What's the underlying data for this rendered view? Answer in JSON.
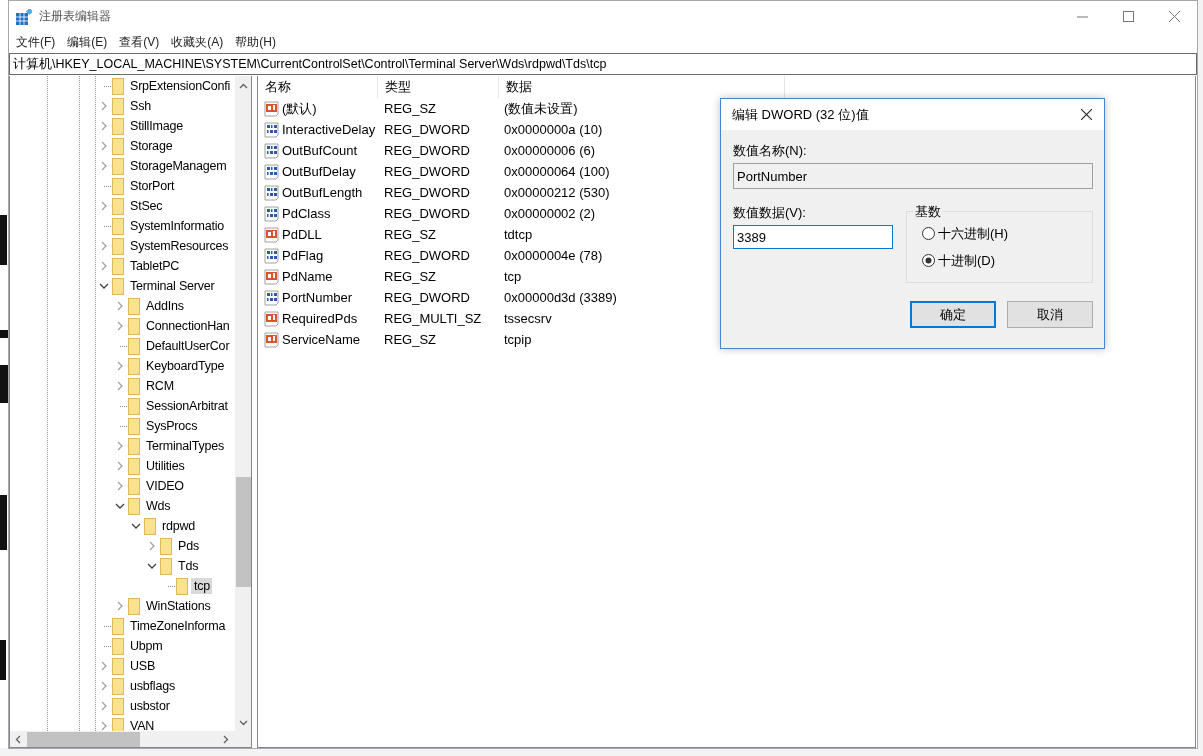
{
  "window": {
    "title": "注册表编辑器"
  },
  "menu": [
    "文件(F)",
    "编辑(E)",
    "查看(V)",
    "收藏夹(A)",
    "帮助(H)"
  ],
  "address": "计算机\\HKEY_LOCAL_MACHINE\\SYSTEM\\CurrentControlSet\\Control\\Terminal Server\\Wds\\rdpwd\\Tds\\tcp",
  "tree": [
    {
      "name": "SrpExtensionConfi",
      "kind": "leaf",
      "selected": false
    },
    {
      "name": "Ssh",
      "kind": "collapsed",
      "selected": false
    },
    {
      "name": "StillImage",
      "kind": "collapsed",
      "selected": false
    },
    {
      "name": "Storage",
      "kind": "collapsed",
      "selected": false
    },
    {
      "name": "StorageManagem",
      "kind": "collapsed",
      "selected": false
    },
    {
      "name": "StorPort",
      "kind": "leaf",
      "selected": false
    },
    {
      "name": "StSec",
      "kind": "collapsed",
      "selected": false
    },
    {
      "name": "SystemInformatio",
      "kind": "leaf",
      "selected": false
    },
    {
      "name": "SystemResources",
      "kind": "collapsed",
      "selected": false
    },
    {
      "name": "TabletPC",
      "kind": "collapsed",
      "selected": false
    },
    {
      "name": "Terminal Server",
      "kind": "expanded",
      "selected": false,
      "children": [
        {
          "name": "AddIns",
          "kind": "collapsed",
          "selected": false
        },
        {
          "name": "ConnectionHan",
          "kind": "collapsed",
          "selected": false
        },
        {
          "name": "DefaultUserCor",
          "kind": "leaf",
          "selected": false
        },
        {
          "name": "KeyboardType",
          "kind": "collapsed",
          "selected": false
        },
        {
          "name": "RCM",
          "kind": "collapsed",
          "selected": false
        },
        {
          "name": "SessionArbitrat",
          "kind": "leaf",
          "selected": false
        },
        {
          "name": "SysProcs",
          "kind": "leaf",
          "selected": false
        },
        {
          "name": "TerminalTypes",
          "kind": "collapsed",
          "selected": false
        },
        {
          "name": "Utilities",
          "kind": "collapsed",
          "selected": false
        },
        {
          "name": "VIDEO",
          "kind": "collapsed",
          "selected": false
        },
        {
          "name": "Wds",
          "kind": "expanded",
          "selected": false,
          "children": [
            {
              "name": "rdpwd",
              "kind": "expanded",
              "selected": false,
              "children": [
                {
                  "name": "Pds",
                  "kind": "collapsed",
                  "selected": false
                },
                {
                  "name": "Tds",
                  "kind": "expanded",
                  "selected": false,
                  "children": [
                    {
                      "name": "tcp",
                      "kind": "leaf",
                      "selected": true
                    }
                  ]
                }
              ]
            }
          ]
        },
        {
          "name": "WinStations",
          "kind": "collapsed",
          "selected": false
        }
      ]
    },
    {
      "name": "TimeZoneInforma",
      "kind": "leaf",
      "selected": false
    },
    {
      "name": "Ubpm",
      "kind": "leaf",
      "selected": false
    },
    {
      "name": "USB",
      "kind": "collapsed",
      "selected": false
    },
    {
      "name": "usbflags",
      "kind": "collapsed",
      "selected": false
    },
    {
      "name": "usbstor",
      "kind": "collapsed",
      "selected": false
    },
    {
      "name": "VAN",
      "kind": "collapsed",
      "selected": false
    }
  ],
  "columns": [
    "名称",
    "类型",
    "数据"
  ],
  "values": [
    {
      "name": "(默认)",
      "type": "REG_SZ",
      "data": "(数值未设置)",
      "kind": "string"
    },
    {
      "name": "InteractiveDelay",
      "type": "REG_DWORD",
      "data": "0x0000000a (10)",
      "kind": "binary"
    },
    {
      "name": "OutBufCount",
      "type": "REG_DWORD",
      "data": "0x00000006 (6)",
      "kind": "binary"
    },
    {
      "name": "OutBufDelay",
      "type": "REG_DWORD",
      "data": "0x00000064 (100)",
      "kind": "binary"
    },
    {
      "name": "OutBufLength",
      "type": "REG_DWORD",
      "data": "0x00000212 (530)",
      "kind": "binary"
    },
    {
      "name": "PdClass",
      "type": "REG_DWORD",
      "data": "0x00000002 (2)",
      "kind": "binary"
    },
    {
      "name": "PdDLL",
      "type": "REG_SZ",
      "data": "tdtcp",
      "kind": "string"
    },
    {
      "name": "PdFlag",
      "type": "REG_DWORD",
      "data": "0x0000004e (78)",
      "kind": "binary"
    },
    {
      "name": "PdName",
      "type": "REG_SZ",
      "data": "tcp",
      "kind": "string"
    },
    {
      "name": "PortNumber",
      "type": "REG_DWORD",
      "data": "0x00000d3d (3389)",
      "kind": "binary"
    },
    {
      "name": "RequiredPds",
      "type": "REG_MULTI_SZ",
      "data": "tssecsrv",
      "kind": "string"
    },
    {
      "name": "ServiceName",
      "type": "REG_SZ",
      "data": "tcpip",
      "kind": "string"
    }
  ],
  "dialog": {
    "title": "编辑 DWORD (32 位)值",
    "name_label": "数值名称(N):",
    "name_value": "PortNumber",
    "data_label": "数值数据(V):",
    "data_value": "3389",
    "base_label": "基数",
    "radios": [
      {
        "label": "十六进制(H)",
        "selected": false
      },
      {
        "label": "十进制(D)",
        "selected": true
      }
    ],
    "buttons": [
      {
        "label": "确定",
        "default": true
      },
      {
        "label": "取消",
        "default": false
      }
    ]
  }
}
